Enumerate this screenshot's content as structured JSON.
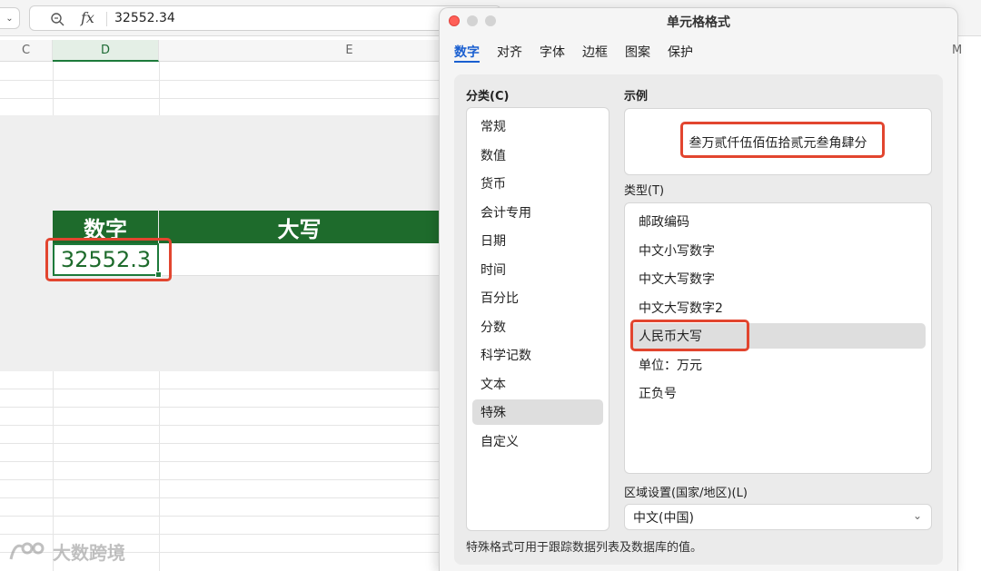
{
  "formula_bar": {
    "value": "32552.34",
    "fx_label": "fx"
  },
  "columns": {
    "c": "C",
    "d": "D",
    "e": "E",
    "m_partial": "M"
  },
  "sheet": {
    "header_number": "数字",
    "header_upper": "大写",
    "cell_value": "32552.3"
  },
  "watermark": {
    "text": "大数跨境"
  },
  "dialog": {
    "title": "单元格格式",
    "tabs": [
      "数字",
      "对齐",
      "字体",
      "边框",
      "图案",
      "保护"
    ],
    "category_label": "分类(C)",
    "categories": [
      "常规",
      "数值",
      "货币",
      "会计专用",
      "日期",
      "时间",
      "百分比",
      "分数",
      "科学记数",
      "文本",
      "特殊",
      "自定义"
    ],
    "selected_category": "特殊",
    "sample_label": "示例",
    "sample_value": "叁万贰仟伍佰伍拾贰元叁角肆分",
    "type_label": "类型(T)",
    "types": [
      "邮政编码",
      "中文小写数字",
      "中文大写数字",
      "中文大写数字2",
      "人民币大写",
      "单位：万元",
      "正负号"
    ],
    "selected_type": "人民币大写",
    "locale_label": "区域设置(国家/地区)(L)",
    "locale_value": "中文(中国)",
    "hint": "特殊格式可用于跟踪数据列表及数据库的值。"
  },
  "colors": {
    "header_green": "#1e6b2c",
    "highlight_red": "#e2452f",
    "active_tab_blue": "#1a5fd0"
  }
}
